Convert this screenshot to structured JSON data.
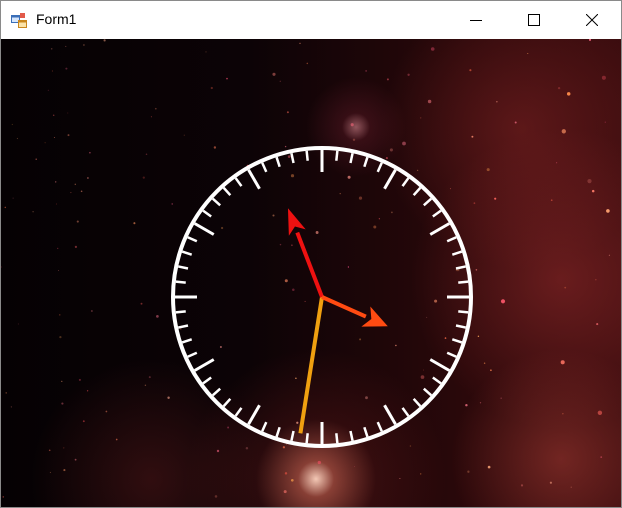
{
  "window": {
    "title": "Form1",
    "icon": "winforms-app-icon",
    "controls": [
      "minimize-icon",
      "maximize-icon",
      "close-icon"
    ]
  },
  "clock": {
    "face_color": "#ffffff",
    "hands": {
      "hour": {
        "minutes_on_dial": 19,
        "color": "#ff4b12"
      },
      "minute": {
        "minutes_on_dial": 56.5,
        "color": "#ee1111"
      },
      "second": {
        "minutes_on_dial": 31.5,
        "color": "#f0a010"
      }
    }
  },
  "background": {
    "theme": "red-nebula-starfield"
  }
}
